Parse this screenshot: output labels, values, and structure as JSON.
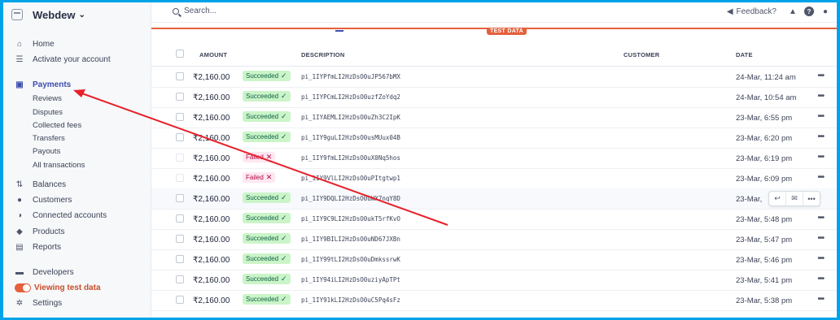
{
  "app": {
    "account_name": "Webdew",
    "search_placeholder": "Search...",
    "feedback_label": "Feedback?",
    "test_data_label": "TEST DATA"
  },
  "sidebar": {
    "primary": [
      {
        "label": "Home",
        "icon": "home-icon"
      },
      {
        "label": "Activate your account",
        "icon": "checklist-icon"
      }
    ],
    "payments": {
      "label": "Payments",
      "icon": "payments-icon"
    },
    "payments_sub": [
      "Reviews",
      "Disputes",
      "Collected fees",
      "Transfers",
      "Payouts",
      "All transactions"
    ],
    "secondary": [
      {
        "label": "Balances",
        "icon": "balances-icon"
      },
      {
        "label": "Customers",
        "icon": "customers-icon"
      },
      {
        "label": "Connected accounts",
        "icon": "connected-accounts-icon"
      },
      {
        "label": "Products",
        "icon": "products-icon"
      },
      {
        "label": "Reports",
        "icon": "reports-icon"
      }
    ],
    "developers": {
      "label": "Developers",
      "icon": "developers-icon"
    },
    "test_mode": {
      "label": "Viewing test data",
      "on": true,
      "color": "#e5603b"
    },
    "settings": {
      "label": "Settings",
      "icon": "gear-icon"
    }
  },
  "table": {
    "headers": {
      "amount": "AMOUNT",
      "description": "DESCRIPTION",
      "customer": "CUSTOMER",
      "date": "DATE"
    },
    "rows": [
      {
        "amount": "₹2,160.00",
        "status": "Succeeded",
        "description": "pi_1IYPfmLI2HzDsO0uJP567bMX",
        "date": "24-Mar, 11:24 am"
      },
      {
        "amount": "₹2,160.00",
        "status": "Succeeded",
        "description": "pi_1IYPCmLI2HzDsO0uzfZoYdq2",
        "date": "24-Mar, 10:54 am"
      },
      {
        "amount": "₹2,160.00",
        "status": "Succeeded",
        "description": "pi_1IYAEMLI2HzDsO0uZh3C2IpK",
        "date": "23-Mar, 6:55 pm"
      },
      {
        "amount": "₹2,160.00",
        "status": "Succeeded",
        "description": "pi_1IY9guLI2HzDsO0usMUux04B",
        "date": "23-Mar, 6:20 pm"
      },
      {
        "amount": "₹2,160.00",
        "status": "Failed",
        "description": "pi_1IY9fmLI2HzDsO0uX0Nq5hos",
        "date": "23-Mar, 6:19 pm"
      },
      {
        "amount": "₹2,160.00",
        "status": "Failed",
        "description": "pi_1IY9VlLI2HzDsO0uPItgtwp1",
        "date": "23-Mar, 6:09 pm"
      },
      {
        "amount": "₹2,160.00",
        "status": "Succeeded",
        "description": "pi_1IY9DQLI2HzDsO0uWX7nqY8D",
        "date": "23-Mar,"
      },
      {
        "amount": "₹2,160.00",
        "status": "Succeeded",
        "description": "pi_1IY9C9LI2HzDsO0ukT5rfKvO",
        "date": "23-Mar, 5:48 pm"
      },
      {
        "amount": "₹2,160.00",
        "status": "Succeeded",
        "description": "pi_1IY9BILI2HzDsO0uND67JXBn",
        "date": "23-Mar, 5:47 pm"
      },
      {
        "amount": "₹2,160.00",
        "status": "Succeeded",
        "description": "pi_1IY99tLI2HzDsO0uDmkssrwK",
        "date": "23-Mar, 5:46 pm"
      },
      {
        "amount": "₹2,160.00",
        "status": "Succeeded",
        "description": "pi_1IY94iLI2HzDsO0uziyApTPt",
        "date": "23-Mar, 5:41 pm"
      },
      {
        "amount": "₹2,160.00",
        "status": "Succeeded",
        "description": "pi_1IY91kLI2HzDsO0uC5Pq4sFz",
        "date": "23-Mar, 5:38 pm"
      }
    ]
  },
  "colors": {
    "accent": "#3d4eac",
    "test_mode": "#e5603b",
    "annotation_arrow": "#e8202a",
    "frame": "#00a2e8"
  }
}
